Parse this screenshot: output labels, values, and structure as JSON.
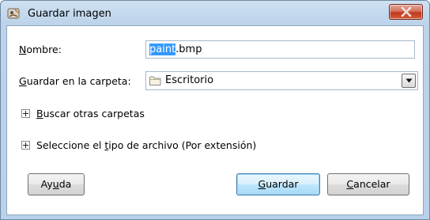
{
  "window": {
    "title": "Guardar imagen"
  },
  "form": {
    "name_label_prefix": "",
    "name_label_mnemonic": "N",
    "name_label_suffix": "ombre:",
    "name_selected": "paint",
    "name_rest": ".bmp",
    "folder_label_mnemonic": "G",
    "folder_label_suffix": "uardar en la carpeta:",
    "folder_value": "Escritorio"
  },
  "expanders": {
    "browse_prefix": "",
    "browse_mnemonic": "B",
    "browse_suffix": "uscar otras carpetas",
    "filetype_prefix": "Seleccione el ",
    "filetype_mnemonic": "t",
    "filetype_suffix": "ipo de archivo (Por extensión)"
  },
  "buttons": {
    "help_prefix": "Ay",
    "help_mnemonic": "u",
    "help_suffix": "da",
    "save_prefix": "",
    "save_mnemonic": "G",
    "save_suffix": "uardar",
    "cancel_prefix": "",
    "cancel_mnemonic": "C",
    "cancel_suffix": "ancelar"
  },
  "colors": {
    "selection": "#3399ff",
    "close_button": "#c0391c"
  },
  "icons": [
    "gimp-app-icon",
    "close-icon",
    "folder-icon",
    "chevron-down-icon",
    "expand-plus-icon"
  ]
}
